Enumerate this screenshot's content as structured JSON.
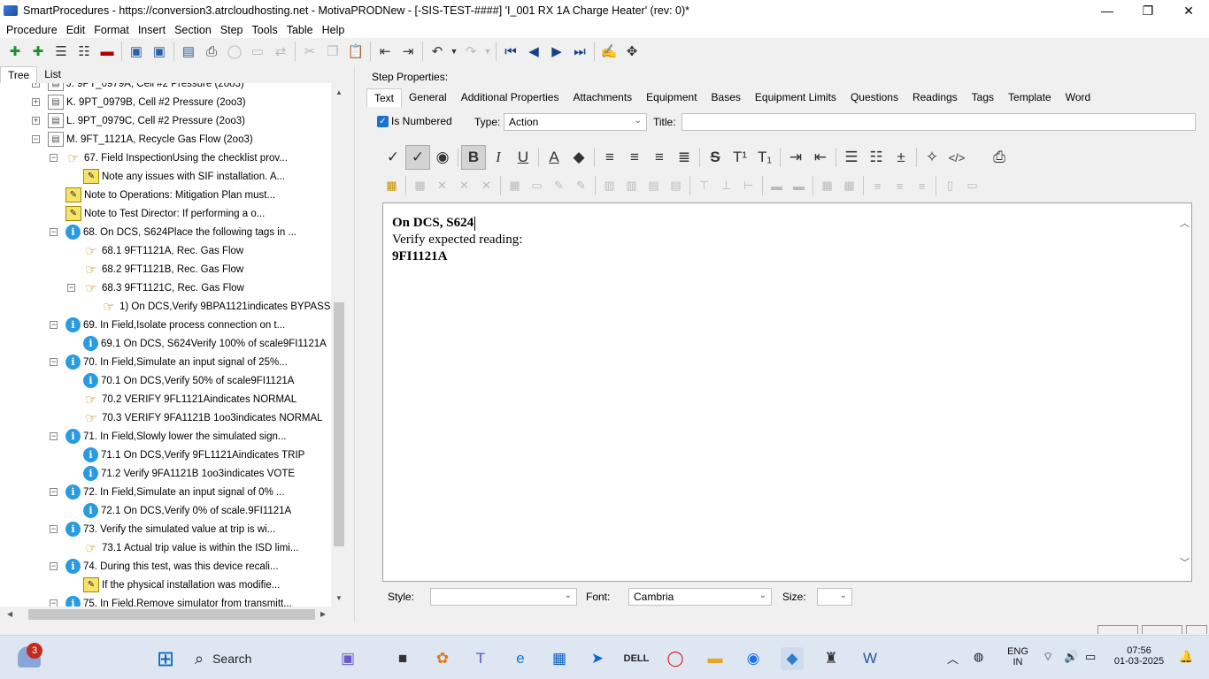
{
  "window": {
    "title": "SmartProcedures - https://conversion3.atrcloudhosting.net - MotivaPRODNew - [-SIS-TEST-####] 'I_001 RX 1A Charge Heater' (rev: 0)*",
    "minimize": "—",
    "maximize": "❐",
    "close": "✕"
  },
  "menu": [
    "Procedure",
    "Edit",
    "Format",
    "Insert",
    "Section",
    "Step",
    "Tools",
    "Table",
    "Help"
  ],
  "left_tabs": [
    "Tree",
    "List"
  ],
  "tree": [
    {
      "text": "J. 9PT_0979A, Cell #2 Pressure (2oo3)",
      "icon": "doc",
      "level": 0,
      "exp": "+"
    },
    {
      "text": "K. 9PT_0979B, Cell #2 Pressure (2oo3)",
      "icon": "doc",
      "level": 0,
      "exp": "+"
    },
    {
      "text": "L. 9PT_0979C, Cell #2 Pressure (2oo3)",
      "icon": "doc",
      "level": 0,
      "exp": "+"
    },
    {
      "text": "M. 9FT_1121A, Recycle Gas Flow (2oo3)",
      "icon": "doc",
      "level": 0,
      "exp": "−"
    },
    {
      "text": "67. Field InspectionUsing the checklist prov...",
      "icon": "hand",
      "level": 1,
      "exp": "−"
    },
    {
      "text": "Note any issues with SIF installation. A...",
      "icon": "note",
      "level": 2,
      "exp": ""
    },
    {
      "text": "Note to Operations: Mitigation Plan must...",
      "icon": "note",
      "level": 1,
      "exp": ""
    },
    {
      "text": "Note to Test Director: If performing a o...",
      "icon": "note",
      "level": 1,
      "exp": ""
    },
    {
      "text": "68. On DCS, S624Place the following tags in ...",
      "icon": "info",
      "level": 1,
      "exp": "−"
    },
    {
      "text": "68.1 9FT1121A, Rec. Gas Flow",
      "icon": "hand",
      "level": 2,
      "exp": ""
    },
    {
      "text": "68.2 9FT1121B, Rec. Gas Flow",
      "icon": "hand",
      "level": 2,
      "exp": ""
    },
    {
      "text": "68.3 9FT1121C, Rec. Gas Flow",
      "icon": "hand",
      "level": 2,
      "exp": "−"
    },
    {
      "text": "1) On DCS,Verify 9BPA1121indicates BYPASS",
      "icon": "hand",
      "level": 3,
      "exp": ""
    },
    {
      "text": "69. In Field,Isolate process connection on t...",
      "icon": "info",
      "level": 1,
      "exp": "−"
    },
    {
      "text": "69.1 On DCS, S624Verify 100% of scale9FI1121A",
      "icon": "info",
      "level": 2,
      "exp": ""
    },
    {
      "text": "70. In Field,Simulate an input signal of 25%...",
      "icon": "info",
      "level": 1,
      "exp": "−"
    },
    {
      "text": "70.1 On DCS,Verify 50% of scale9FI1121A",
      "icon": "info",
      "level": 2,
      "exp": ""
    },
    {
      "text": "70.2 VERIFY 9FL1121Aindicates NORMAL",
      "icon": "hand",
      "level": 2,
      "exp": ""
    },
    {
      "text": "70.3 VERIFY 9FA1121B 1oo3indicates NORMAL",
      "icon": "hand",
      "level": 2,
      "exp": ""
    },
    {
      "text": "71. In Field,Slowly lower the simulated sign...",
      "icon": "info",
      "level": 1,
      "exp": "−"
    },
    {
      "text": "71.1 On DCS,Verify 9FL1121Aindicates TRIP",
      "icon": "info",
      "level": 2,
      "exp": ""
    },
    {
      "text": "71.2 Verify 9FA1121B 1oo3indicates VOTE",
      "icon": "info",
      "level": 2,
      "exp": ""
    },
    {
      "text": "72. In Field,Simulate an input signal of 0% ...",
      "icon": "info",
      "level": 1,
      "exp": "−"
    },
    {
      "text": "72.1 On DCS,Verify 0% of scale.9FI1121A",
      "icon": "info",
      "level": 2,
      "exp": ""
    },
    {
      "text": "73. Verify the simulated value at trip is wi...",
      "icon": "info",
      "level": 1,
      "exp": "−"
    },
    {
      "text": "73.1 Actual trip value is within the ISD limi...",
      "icon": "hand",
      "level": 2,
      "exp": ""
    },
    {
      "text": "74. During this test, was this device recali...",
      "icon": "info",
      "level": 1,
      "exp": "−"
    },
    {
      "text": "If the physical installation was modifie...",
      "icon": "note",
      "level": 2,
      "exp": ""
    },
    {
      "text": "75. In Field,Remove simulator from transmitt...",
      "icon": "info",
      "level": 1,
      "exp": "−"
    }
  ],
  "step": {
    "header": "Step Properties:",
    "tabs": [
      "Text",
      "General",
      "Additional Properties",
      "Attachments",
      "Equipment",
      "Bases",
      "Equipment Limits",
      "Questions",
      "Readings",
      "Tags",
      "Template",
      "Word"
    ],
    "is_numbered_label": "Is Numbered",
    "is_numbered_checked": true,
    "type_label": "Type:",
    "type_value": "Action",
    "title_label": "Title:",
    "title_value": ""
  },
  "editor": {
    "line1": "On DCS, S624",
    "line2": "Verify expected reading:",
    "line3": "9FI1121A"
  },
  "bottom": {
    "style_label": "Style:",
    "style_value": "",
    "font_label": "Font:",
    "font_value": "Cambria",
    "size_label": "Size:",
    "size_value": ""
  },
  "taskbar": {
    "search": "Search",
    "notif_count": "3",
    "lang1": "ENG",
    "lang2": "IN",
    "time": "07:56",
    "date": "01-03-2025"
  },
  "colors": {
    "accent": "#1a73c9",
    "info": "#2b9be0",
    "taskbar": "#dde6f1"
  }
}
